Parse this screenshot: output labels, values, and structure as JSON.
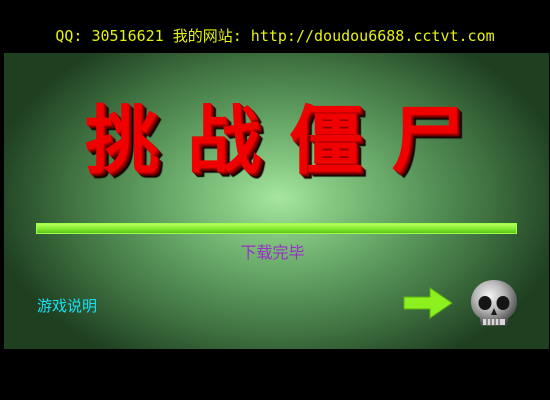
{
  "header": {
    "text": "QQ: 30516621  我的网站: http://doudou6688.cctvt.com"
  },
  "game": {
    "title": "挑战僵尸",
    "status": "下载完毕",
    "help_label": "游戏说明",
    "progress": 1.0
  },
  "icons": {
    "next": "right-arrow-icon",
    "skull": "skull-icon"
  },
  "colors": {
    "header_text": "#e5f20c",
    "title": "#f00000",
    "progress": "#7ee82a",
    "status": "#9a2fc8",
    "help": "#18e0f4",
    "arrow": "#8cf01e"
  }
}
